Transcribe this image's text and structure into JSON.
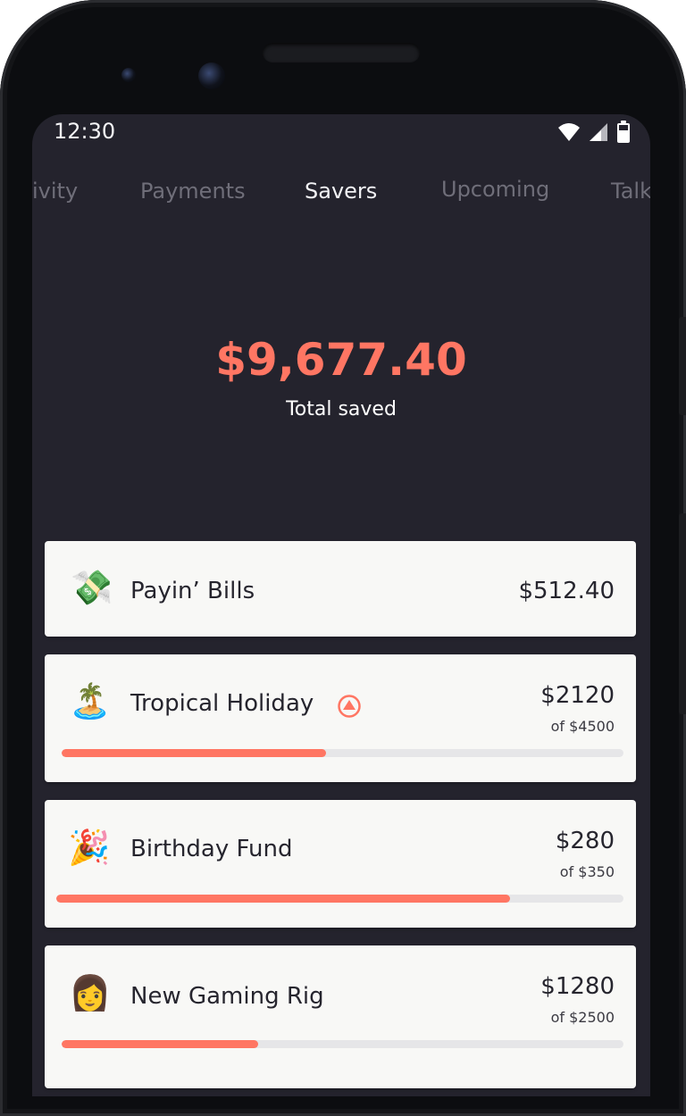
{
  "status_bar": {
    "time": "12:30"
  },
  "icons": {
    "wifi": "wifi-icon",
    "signal": "signal-icon",
    "battery": "battery-icon",
    "alert": "upward-arrow-circle-icon"
  },
  "tabs": [
    {
      "label": "ivity",
      "active": false
    },
    {
      "label": "Payments",
      "active": false
    },
    {
      "label": "Savers",
      "active": true
    },
    {
      "label": "Upcoming",
      "active": false
    },
    {
      "label": "Talk",
      "active": false
    }
  ],
  "summary": {
    "total_amount": "$9,677.40",
    "total_label": "Total saved"
  },
  "savers": [
    {
      "icon": "💸",
      "title": "Payin’ Bills",
      "amount": "$512.40"
    },
    {
      "icon": "🏝️",
      "title": "Tropical Holiday",
      "amount": "$2120",
      "goal": "of $4500",
      "progress": 0.47
    },
    {
      "icon": "🎉",
      "title": "Birthday Fund",
      "amount": "$280",
      "goal": "of $350",
      "progress": 0.8
    },
    {
      "icon": "👩",
      "title": "New Gaming Rig",
      "amount": "$1280",
      "goal": "of $2500",
      "progress": 0.35
    }
  ],
  "colors": {
    "screen_background": "#24232d",
    "accent": "#ff7663",
    "card_background": "#f8f8f6",
    "progress_track": "#e6e6e8",
    "tab_inactive": "#6f6e79",
    "tab_active": "#f2f2f5"
  }
}
